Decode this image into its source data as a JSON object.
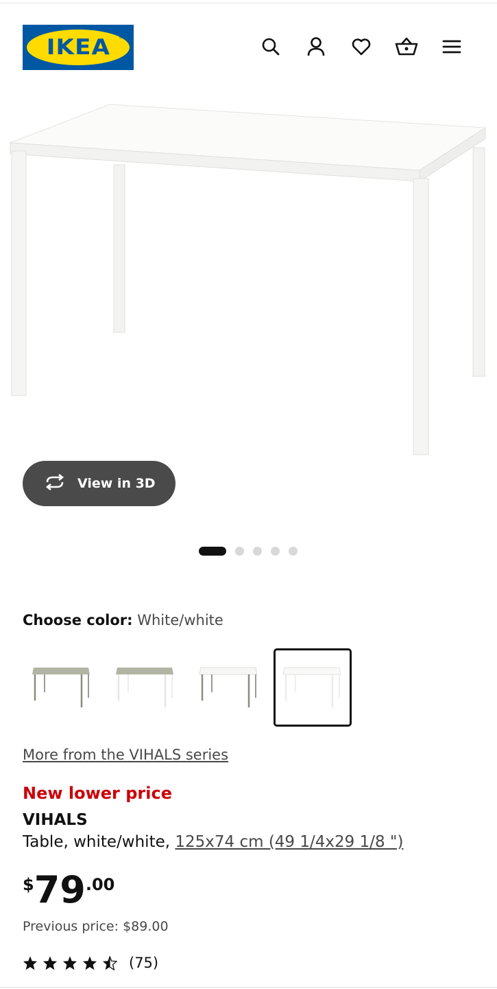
{
  "header": {
    "logo_text": "IKEA",
    "logo_reg": "®",
    "icons": [
      "search-icon",
      "profile-icon",
      "heart-icon",
      "cart-icon",
      "menu-icon"
    ]
  },
  "hero": {
    "view3d_label": "View in 3D",
    "carousel": {
      "total": 5,
      "active": 1
    }
  },
  "color": {
    "label": "Choose color:",
    "value": "White/white",
    "options": [
      "gray-green/gray",
      "gray-green/white",
      "white/gray",
      "white/white"
    ],
    "selected_index": 4
  },
  "series_link": "More from the VIHALS series",
  "product": {
    "badge": "New lower price",
    "name": "VIHALS",
    "desc_prefix": "Table, white/white, ",
    "dimensions": "125x74 cm (49 1/4x29 1/8 \")",
    "price": {
      "currency": "$",
      "integer": "79",
      "decimal": ".00"
    },
    "previous_price": "Previous price: $89.00",
    "rating": {
      "stars": 4.5,
      "count": "(75)"
    }
  },
  "colors": {
    "ikea_blue": "#0058a3",
    "ikea_yellow": "#ffdb00",
    "sale_red": "#cc0008",
    "button_dark": "#4a4a4a"
  }
}
